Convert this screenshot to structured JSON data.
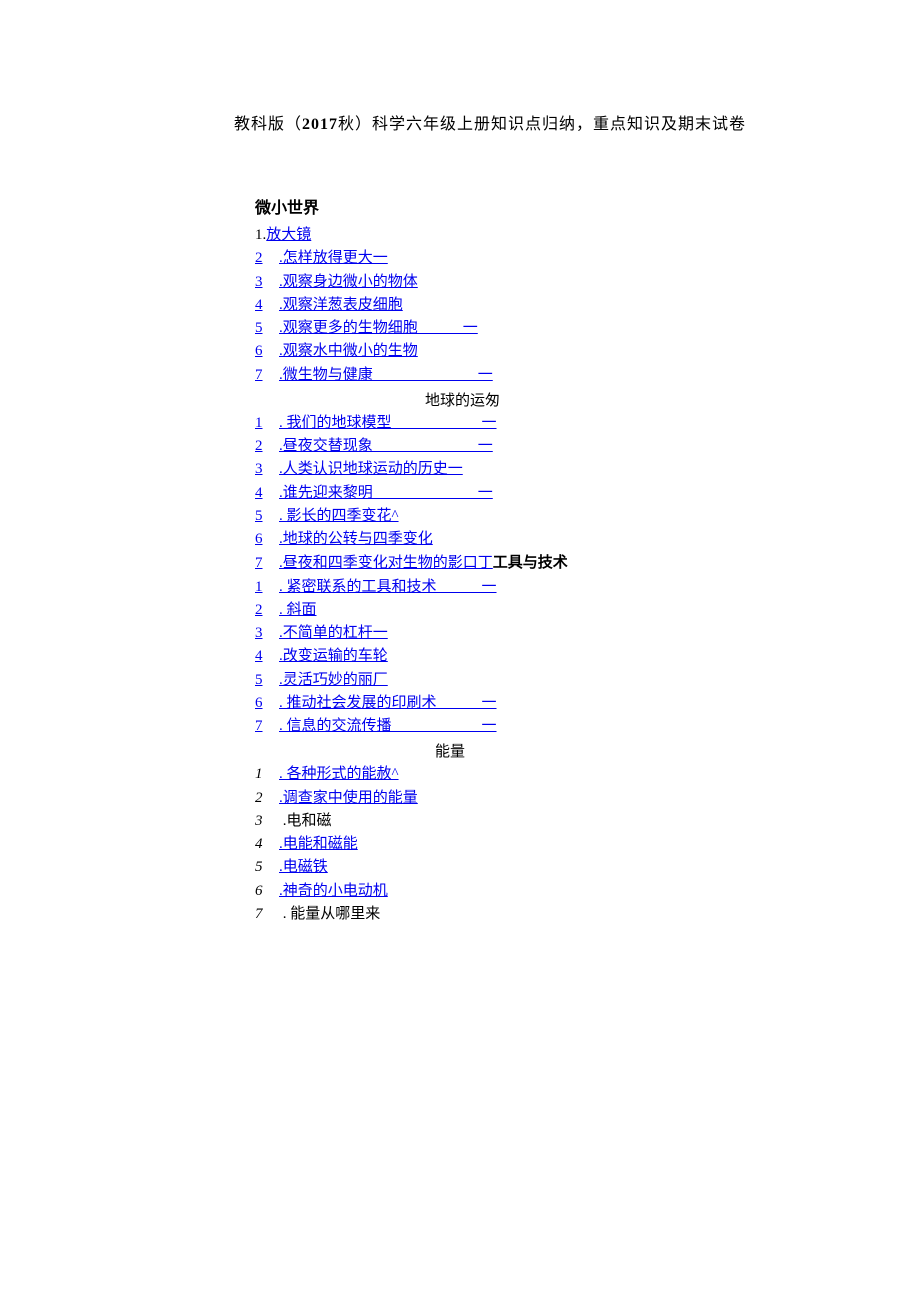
{
  "title": {
    "prefix": "教科版（",
    "bold": "2017",
    "suffix": "秋）科学六年级上册知识点归纳，重点知识及期末试卷"
  },
  "sections": [
    {
      "heading": "微小世界",
      "items": [
        {
          "num": "1.",
          "text": "放大镜",
          "link": true,
          "numlink": false,
          "spaced": false
        },
        {
          "num": "2",
          "text": ".怎样放得更大一",
          "link": true,
          "numlink": true,
          "spaced": true
        },
        {
          "num": "3",
          "text": ".观察身边微小的物体",
          "link": true,
          "numlink": true,
          "spaced": true
        },
        {
          "num": "4",
          "text": ".观察洋葱表皮细胞",
          "link": true,
          "numlink": true,
          "spaced": true
        },
        {
          "num": "5",
          "text": ".观察更多的生物细胞   一",
          "link": true,
          "numlink": true,
          "spaced": true
        },
        {
          "num": "6",
          "text": ".观察水中微小的生物",
          "link": true,
          "numlink": true,
          "spaced": true
        },
        {
          "num": "7",
          "text": ".微生物与健康       一",
          "link": true,
          "numlink": true,
          "spaced": true
        }
      ]
    },
    {
      "separator": "地球的运匆",
      "sep_align": "center",
      "items": [
        {
          "num": "1",
          "text": ". 我们的地球模型      一",
          "link": true,
          "numlink": true,
          "spaced": true
        },
        {
          "num": "2",
          "text": ".昼夜交替现象       一",
          "link": true,
          "numlink": true,
          "spaced": true
        },
        {
          "num": "3",
          "text": ".人类认识地球运动的历史一",
          "link": true,
          "numlink": true,
          "spaced": true
        },
        {
          "num": "4",
          "text": ".谁先迎来黎明       一",
          "link": true,
          "numlink": true,
          "spaced": true
        },
        {
          "num": "5",
          "text": ". 影长的四季变花^",
          "link": true,
          "numlink": true,
          "spaced": true
        },
        {
          "num": "6",
          "text": ".地球的公转与四季变化",
          "link": true,
          "numlink": true,
          "spaced": true
        },
        {
          "num": "7",
          "text": ".昼夜和四季变化对生物的影口丁",
          "link": true,
          "numlink": true,
          "spaced": true,
          "inline_heading": "工具与技术"
        }
      ]
    },
    {
      "items": [
        {
          "num": "1",
          "text": ". 紧密联系的工具和技术   一",
          "link": true,
          "numlink": true,
          "spaced": true
        },
        {
          "num": "2",
          "text": ". 斜面",
          "link": true,
          "numlink": true,
          "spaced": true
        },
        {
          "num": "3",
          "text": ".不简单的杠杆一",
          "link": true,
          "numlink": true,
          "spaced": true
        },
        {
          "num": "4",
          "text": ".改变运输的车轮",
          "link": true,
          "numlink": true,
          "spaced": true
        },
        {
          "num": "5",
          "text": ".灵活巧妙的丽厂",
          "link": true,
          "numlink": true,
          "spaced": true
        },
        {
          "num": "6",
          "text": ". 推动社会发展的印刷术   一",
          "link": true,
          "numlink": true,
          "spaced": true
        },
        {
          "num": "7",
          "text": ". 信息的交流传播      一",
          "link": true,
          "numlink": true,
          "spaced": true
        }
      ]
    },
    {
      "separator": "能量",
      "sep_align": "right",
      "items": [
        {
          "num": "1",
          "text": ". 各种形式的能赦^",
          "link": true,
          "numlink": false,
          "spaced": true,
          "italic": true
        },
        {
          "num": "2",
          "text": ".调查家中使用的能量",
          "link": true,
          "numlink": false,
          "spaced": true,
          "italic": true
        },
        {
          "num": "3",
          "text": " .电和磁",
          "link": false,
          "numlink": false,
          "spaced": true,
          "italic": true
        },
        {
          "num": "4",
          "text": ".电能和磁能",
          "link": true,
          "numlink": false,
          "spaced": true,
          "italic": true
        },
        {
          "num": "5",
          "text": ".电磁铁",
          "link": true,
          "numlink": false,
          "spaced": true,
          "italic": true
        },
        {
          "num": "6",
          "text": ".神奇的小电动机",
          "link": true,
          "numlink": false,
          "spaced": true,
          "italic": true
        },
        {
          "num": "7",
          "text": " . 能量从哪里来",
          "link": false,
          "numlink": false,
          "spaced": true,
          "italic": true
        }
      ]
    }
  ]
}
